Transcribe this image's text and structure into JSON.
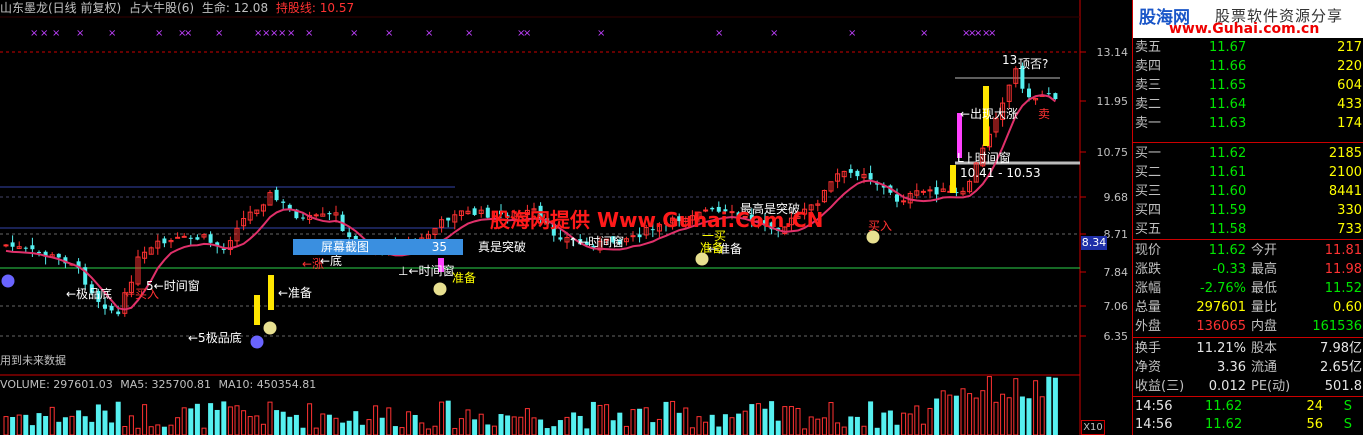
{
  "header": {
    "title": "山东墨龙(日线 前复权)",
    "indicator": "占大牛股(6)",
    "life_label": "生命:",
    "life_value": "12.08",
    "hold_label": "持股线:",
    "hold_value": "10.57"
  },
  "chart_data": {
    "type": "candlestick",
    "y_axis_ticks": [
      "13.14",
      "11.95",
      "10.75",
      "9.68",
      "8.71",
      "7.84",
      "7.06",
      "6.35"
    ],
    "current_price_tag": "8.34",
    "annotations": [
      "←极品底",
      "←买入",
      "5←时间窗",
      "←5极品底",
      "←准备",
      "←涨",
      "⊥←时间窗",
      "准备",
      "←底",
      "准备",
      "真是突破",
      "↑←时间窗",
      "一买",
      "←准备",
      "最高是突破",
      "买入",
      "←出现大涨",
      "Lㅏ时间窗",
      "10.41 - 10.53",
      "13.",
      "顶否?",
      "卖"
    ],
    "footer_note": "用到未来数据",
    "volume": {
      "label": "VOLUME:",
      "value": "297601.03",
      "ma5_label": "MA5:",
      "ma5": "325700.81",
      "ma10_label": "MA10:",
      "ma10": "450354.81"
    },
    "volume_scale": "X10"
  },
  "watermark": "股海网提供 Www.Guhai.Com.CN",
  "screenshot_bar": {
    "label": "屏幕截图",
    "count": "35"
  },
  "logo": {
    "brand": "股海网",
    "slogan": "股票软件资源分享",
    "url": "www.Guhai.com.cn"
  },
  "colors": {
    "up": "#ff3232",
    "down": "#00e600",
    "flat": "#e6e6e6",
    "volume": "#ffff00",
    "border": "#cc0000"
  },
  "order_book": {
    "asks": [
      {
        "label": "卖五",
        "price": "11.67",
        "vol": "217"
      },
      {
        "label": "卖四",
        "price": "11.66",
        "vol": "220"
      },
      {
        "label": "卖三",
        "price": "11.65",
        "vol": "604"
      },
      {
        "label": "卖二",
        "price": "11.64",
        "vol": "433"
      },
      {
        "label": "卖一",
        "price": "11.63",
        "vol": "174"
      }
    ],
    "bids": [
      {
        "label": "买一",
        "price": "11.62",
        "vol": "2185"
      },
      {
        "label": "买二",
        "price": "11.61",
        "vol": "2100"
      },
      {
        "label": "买三",
        "price": "11.60",
        "vol": "8441"
      },
      {
        "label": "买四",
        "price": "11.59",
        "vol": "330"
      },
      {
        "label": "买五",
        "price": "11.58",
        "vol": "733"
      }
    ]
  },
  "quote": {
    "now_label": "现价",
    "now": "11.62",
    "open_label": "今开",
    "open": "11.81",
    "chg_label": "涨跌",
    "chg": "-0.33",
    "high_label": "最高",
    "high": "11.98",
    "pct_label": "涨幅",
    "pct": "-2.76%",
    "low_label": "最低",
    "low": "11.52",
    "vol_label": "总量",
    "vol": "297601",
    "vr_label": "量比",
    "vr": "0.60",
    "out_label": "外盘",
    "out": "136065",
    "in_label": "内盘",
    "in": "161536",
    "turn_label": "换手",
    "turn": "11.21%",
    "cap_label": "股本",
    "cap": "7.98亿",
    "nav_label": "净资",
    "nav": "3.36",
    "float_label": "流通",
    "float": "2.65亿",
    "eps_label": "收益(三)",
    "eps": "0.012",
    "pe_label": "PE(动)",
    "pe": "501.8"
  },
  "ticks": [
    {
      "time": "14:56",
      "price": "11.62",
      "vol": "24",
      "side": "S"
    },
    {
      "time": "14:56",
      "price": "11.62",
      "vol": "56",
      "side": "S"
    }
  ]
}
